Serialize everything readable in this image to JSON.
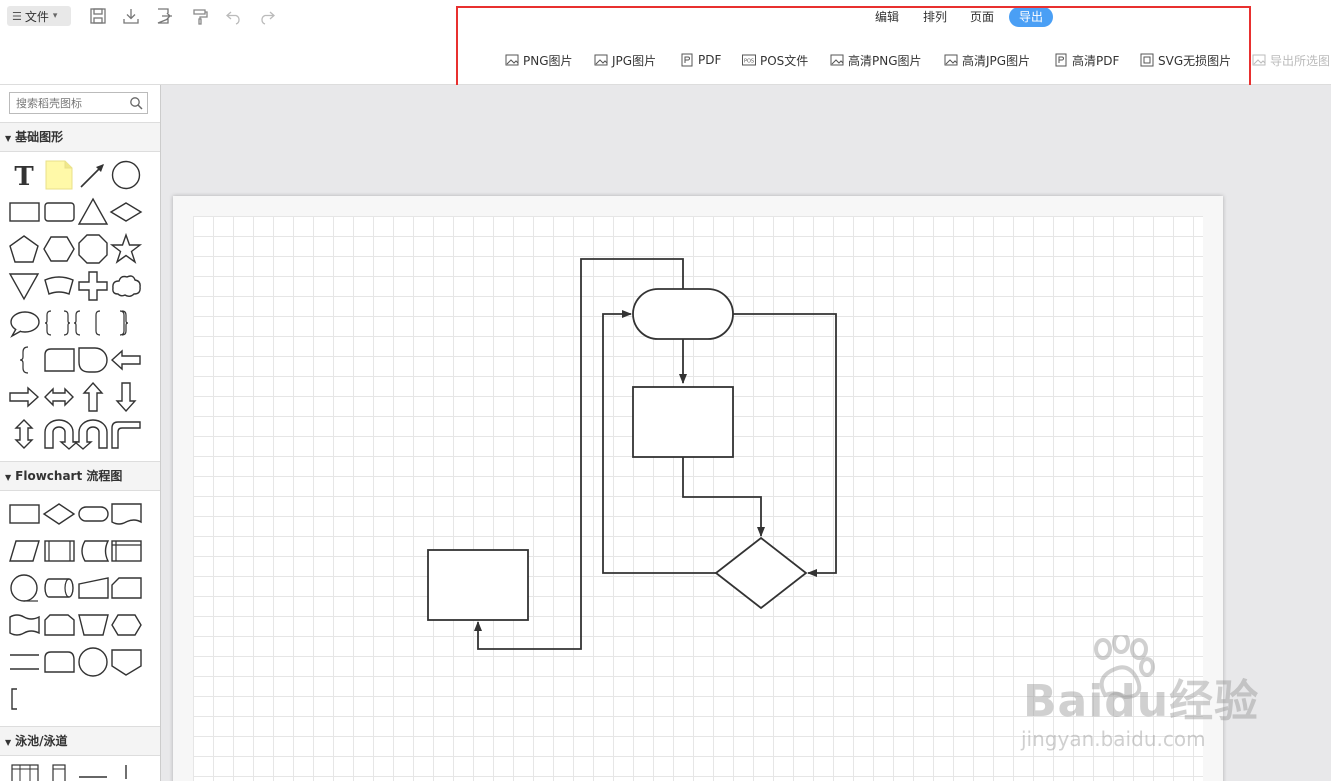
{
  "toolbar": {
    "file_label": "文件",
    "tabs": [
      "编辑",
      "排列",
      "页面",
      "导出"
    ],
    "active_tab": "导出",
    "accent": "#4a9ff5",
    "highlight_color": "#e8302f"
  },
  "export": {
    "items": [
      "PNG图片",
      "JPG图片",
      "PDF",
      "POS文件",
      "高清PNG图片",
      "高清JPG图片",
      "高清PDF",
      "SVG无损图片",
      "导出所选图"
    ]
  },
  "sidebar": {
    "search_placeholder": "搜索稻壳图标",
    "categories": [
      "基础图形",
      "Flowchart 流程图",
      "泳池/泳道"
    ]
  },
  "watermark": {
    "logo": "Baidu经验",
    "url": "jingyan.baidu.com"
  }
}
